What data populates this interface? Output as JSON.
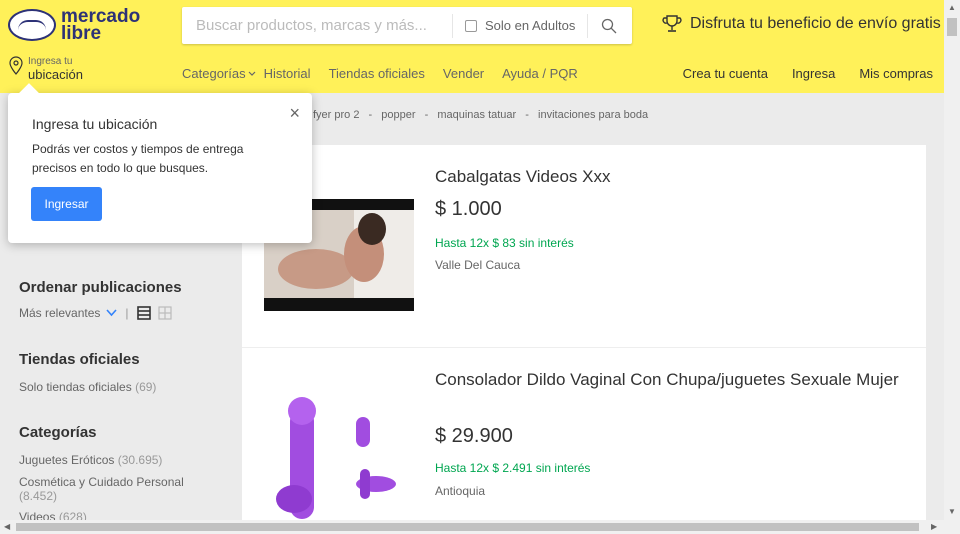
{
  "header": {
    "logo_line1": "mercado",
    "logo_line2": "libre",
    "search_placeholder": "Buscar productos, marcas y más...",
    "adult_label": "Solo en Adultos",
    "shipping_promo": "Disfruta tu beneficio de envío gratis",
    "location_small": "Ingresa tu",
    "location_big": "ubicación",
    "nav": [
      "Categorías",
      "Historial",
      "Tiendas oficiales",
      "Vender",
      "Ayuda / PQR"
    ],
    "account": [
      "Crea tu cuenta",
      "Ingresa",
      "Mis compras"
    ]
  },
  "related_searches": [
    "fyer pro 2",
    "-",
    "popper",
    "-",
    "maquinas tatuar",
    "-",
    "invitaciones para boda"
  ],
  "popup": {
    "title": "Ingresa tu ubicación",
    "body": "Podrás ver costos y tiempos de entrega precisos en todo lo que busques.",
    "button": "Ingresar",
    "close": "×"
  },
  "sidebar": {
    "sort_title": "Ordenar publicaciones",
    "sort_value": "Más relevantes",
    "stores_title": "Tiendas oficiales",
    "stores_item": "Solo tiendas oficiales",
    "stores_count": "(69)",
    "categories_title": "Categorías",
    "categories": [
      {
        "label": "Juguetes Eróticos",
        "count": "(30.695)"
      },
      {
        "label": "Cosmética y Cuidado Personal",
        "count": "(8.452)"
      },
      {
        "label": "Videos",
        "count": "(628)"
      }
    ]
  },
  "results": [
    {
      "title": "Cabalgatas Videos Xxx",
      "price": "$ 1.000",
      "installments": "Hasta 12x $ 83 sin interés",
      "location": "Valle Del Cauca"
    },
    {
      "title": "Consolador Dildo Vaginal Con Chupa/juguetes Sexuale Mujer",
      "price": "$ 29.900",
      "installments": "Hasta 12x $ 2.491 sin interés",
      "location": "Antioquia"
    }
  ],
  "colors": {
    "header_bg": "#fff159",
    "brand_blue": "#2d3277",
    "button_blue": "#3483fa",
    "green": "#00a650"
  }
}
